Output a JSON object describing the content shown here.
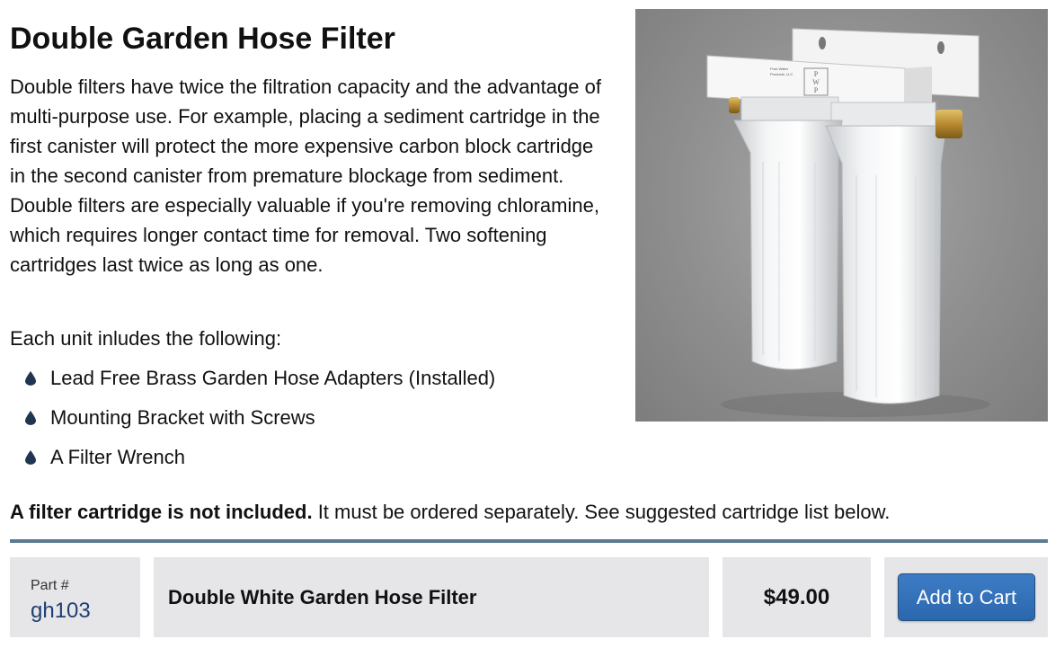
{
  "product": {
    "title": "Double Garden Hose Filter",
    "description": "Double filters have twice the filtration capacity and the advantage of multi-purpose use. For example, placing a sediment cartridge in the first canister will protect the more expensive carbon block cartridge in the second canister from premature blockage from sediment. Double filters are especially valuable if you're removing chloramine, which requires longer contact time for removal. Two softening cartridges last twice as long as one.",
    "includes_heading": "Each unit inludes the following:",
    "includes": [
      "Lead Free Brass Garden Hose Adapters (Installed)",
      "Mounting Bracket with Screws",
      "A Filter Wrench"
    ],
    "bullet_icon": "water-drop-icon",
    "notice_bold": "A filter cartridge is not included.",
    "notice_rest": " It must be ordered separately. See suggested cartridge list below."
  },
  "photo": {
    "bracket_label_lines": [
      "Pure Water",
      "Products, LLC"
    ],
    "logo_letters": [
      "P",
      "W",
      "P"
    ]
  },
  "order_row": {
    "part_label": "Part #",
    "part_number": "gh103",
    "name": "Double White Garden Hose Filter",
    "price": "$49.00",
    "cart_button": "Add to Cart"
  },
  "colors": {
    "divider": "#5c7a90",
    "cell_background": "#e6e6e8",
    "button": "#2f6db3",
    "part_number": "#1e3f72",
    "bullet": "#1f3550"
  }
}
